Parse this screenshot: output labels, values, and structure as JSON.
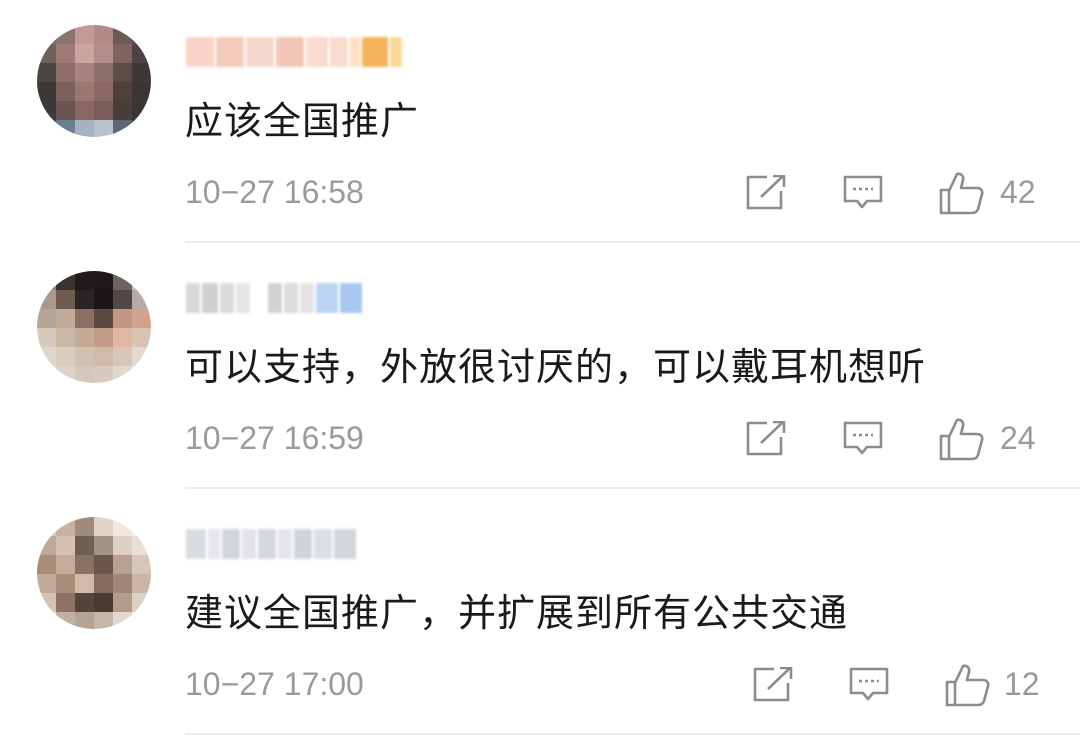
{
  "comments": [
    {
      "content": "应该全国推广",
      "time": "10−27 16:58",
      "likes": "42"
    },
    {
      "content": "可以支持，外放很讨厌的，可以戴耳机想听",
      "time": "10−27 16:59",
      "likes": "24"
    },
    {
      "content": "建议全国推广，并扩展到所有公共交通",
      "time": "10−27 17:00",
      "likes": "12"
    }
  ],
  "icons": {
    "share": "share-icon",
    "reply": "comment-reply-icon",
    "like": "thumbs-up-icon"
  },
  "colors": {
    "text": "#1a1a1a",
    "meta": "#9a9a9a",
    "divider": "#ececec"
  }
}
